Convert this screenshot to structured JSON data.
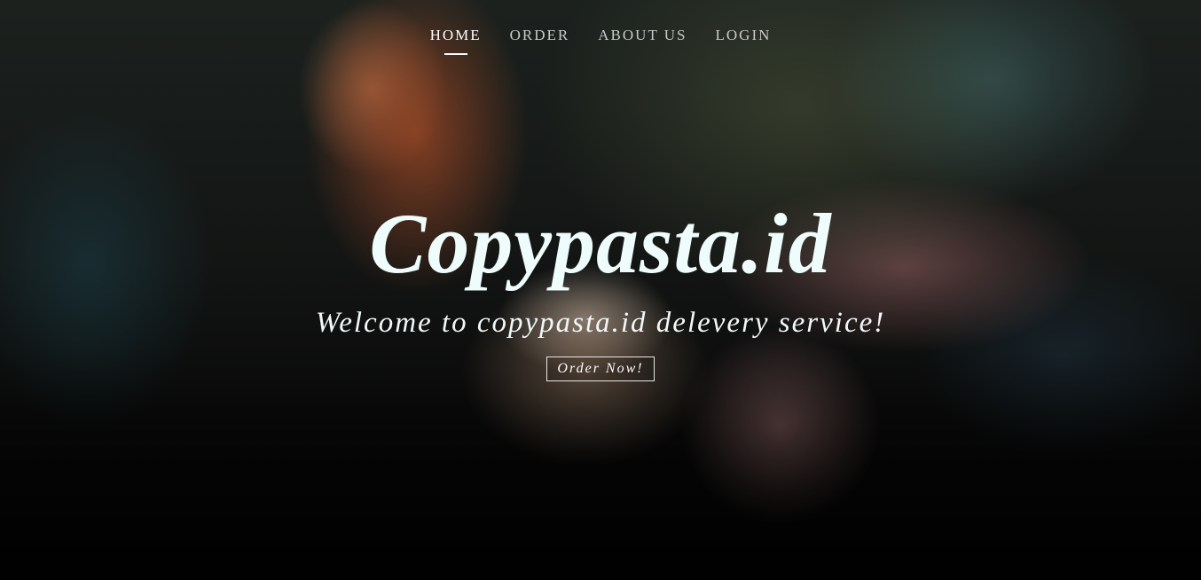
{
  "nav": {
    "items": [
      {
        "label": "HOME",
        "active": true
      },
      {
        "label": "ORDER",
        "active": false
      },
      {
        "label": "ABOUT US",
        "active": false
      },
      {
        "label": "LOGIN",
        "active": false
      }
    ]
  },
  "hero": {
    "title": "Copypasta.id",
    "subtitle": "Welcome to copypasta.id delevery service!",
    "cta_label": "Order Now!"
  },
  "colors": {
    "text": "#ffffff",
    "title": "#eefcfc"
  }
}
